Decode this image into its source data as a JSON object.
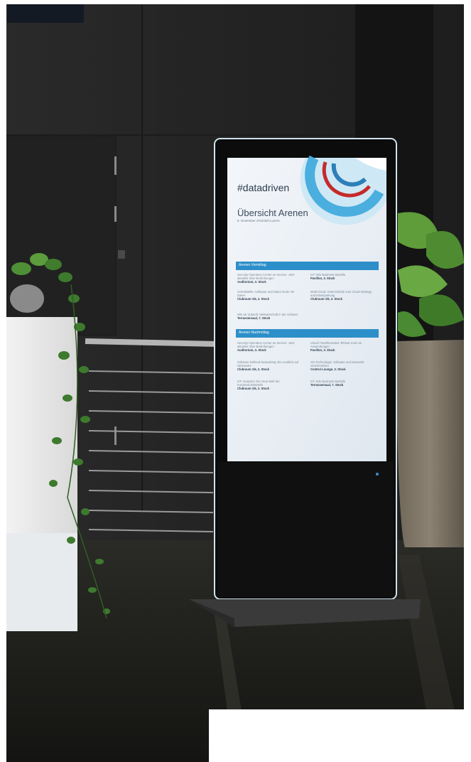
{
  "screen": {
    "hashtag": "#datadriven",
    "title": "Übersicht Arenen",
    "subtitle": "5. November 2018 Bel Luzern",
    "sections": [
      {
        "heading": "Arenen Vormittag",
        "entries": [
          {
            "text": "Security-Operation Center as Service: Jetzt aktueller über Bedrohungen",
            "room": "Auditorium, 3. Stock"
          },
          {
            "text": "IoT: Wie Business Modelle",
            "room": "Pavillon, 3. Stock"
          },
          {
            "text": "Schnittstelle: Software und Daten heute mit Daten",
            "room": "Clubraum 1/6, 2. Stock"
          },
          {
            "text": "Multi-Cloud: Unterschiede zum Cloud-Strategy und Datenplanung",
            "room": "Clubraum 1/6, 2. Stock"
          },
          {
            "text": "Wie wir Zukunft: Weltwirtschaft in der Schweiz",
            "room": "Terrassensaal, 7. Stock"
          }
        ]
      },
      {
        "heading": "Arenen Nachmittag",
        "entries": [
          {
            "text": "Security-Operation Center as Service: Jetzt aktueller über Bedrohungen",
            "room": "Auditorium, 3. Stock"
          },
          {
            "text": "Cloud-Transformation: BPaaS rund um Anwendungen",
            "room": "Pavillon, 3. Stock"
          },
          {
            "text": "Software Defined Networking: Ein Ausblick auf Netzwerke",
            "room": "Clubraum 1/6, 2. Stock"
          },
          {
            "text": "OS-Technologie: Software und Netzwerk verschmelzen",
            "room": "Control Lounge, 2. Stock"
          },
          {
            "text": "IoT-Analytics: Die neue Welt der Kundenschnittstelle",
            "room": "Clubraum 1/6, 2. Stock"
          },
          {
            "text": "IoT: Wie Business Modelle",
            "room": "Terrassensaal, 7. Stock"
          }
        ]
      }
    ]
  },
  "colors": {
    "wall": "#262626",
    "floor": "#1c1c1a",
    "screen": "#eef2f6",
    "accent_blue": "#2d8fc9",
    "plant_green": "#3d7a2e"
  }
}
